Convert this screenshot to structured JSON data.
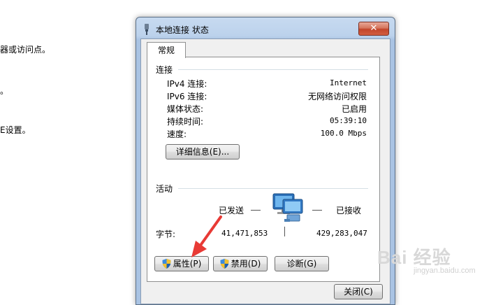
{
  "background": {
    "line1": "器或访问点。",
    "line2": "。",
    "line3": "E设置。"
  },
  "window": {
    "title": "本地连接 状态",
    "close_label": "✕"
  },
  "tab": {
    "label": "常规"
  },
  "connection": {
    "heading": "连接",
    "rows": [
      {
        "label": "IPv4 连接:",
        "value": "Internet"
      },
      {
        "label": "IPv6 连接:",
        "value": "无网络访问权限"
      },
      {
        "label": "媒体状态:",
        "value": "已启用"
      },
      {
        "label": "持续时间:",
        "value": "05:39:10"
      },
      {
        "label": "速度:",
        "value": "100.0 Mbps"
      }
    ],
    "details_button": "详细信息(E)..."
  },
  "activity": {
    "heading": "活动",
    "sent_label": "已发送",
    "received_label": "已接收",
    "bytes_label": "字节:",
    "bytes_sent": "41,471,853",
    "bytes_received": "429,283,047"
  },
  "buttons": {
    "properties": "属性(P)",
    "disable": "禁用(D)",
    "diagnose": "诊断(G)",
    "close": "关闭(C)"
  },
  "watermark": {
    "main": "Bai 经验",
    "sub": "jingyan.baidu.com"
  },
  "colors": {
    "arrow": "#e83a35",
    "close_button": "#c2452b"
  }
}
